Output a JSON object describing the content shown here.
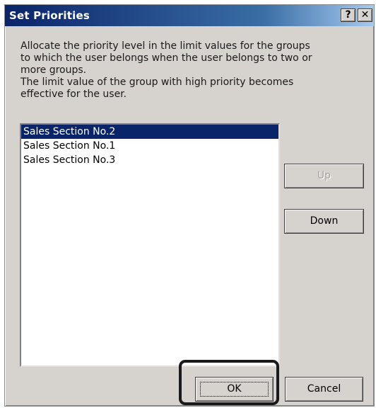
{
  "window": {
    "title": "Set Priorities",
    "help_label": "?",
    "close_label": "✕"
  },
  "description": {
    "lines": [
      "Allocate the priority level in the limit values for the groups",
      "to which the user belongs when the user belongs to two or",
      "more groups.",
      "The limit value of the group with high priority becomes",
      "effective for the user."
    ]
  },
  "list": {
    "items": [
      {
        "label": "Sales Section No.2",
        "selected": true
      },
      {
        "label": "Sales Section No.1",
        "selected": false
      },
      {
        "label": "Sales Section No.3",
        "selected": false
      }
    ]
  },
  "buttons": {
    "up_label": "Up",
    "up_enabled": false,
    "down_label": "Down",
    "ok_label": "OK",
    "cancel_label": "Cancel"
  },
  "colors": {
    "title_bar": "#0a246a",
    "dialog_face": "#d6d3ce",
    "selection": "#0a246a",
    "highlight_outline": "#1a1a1a"
  }
}
